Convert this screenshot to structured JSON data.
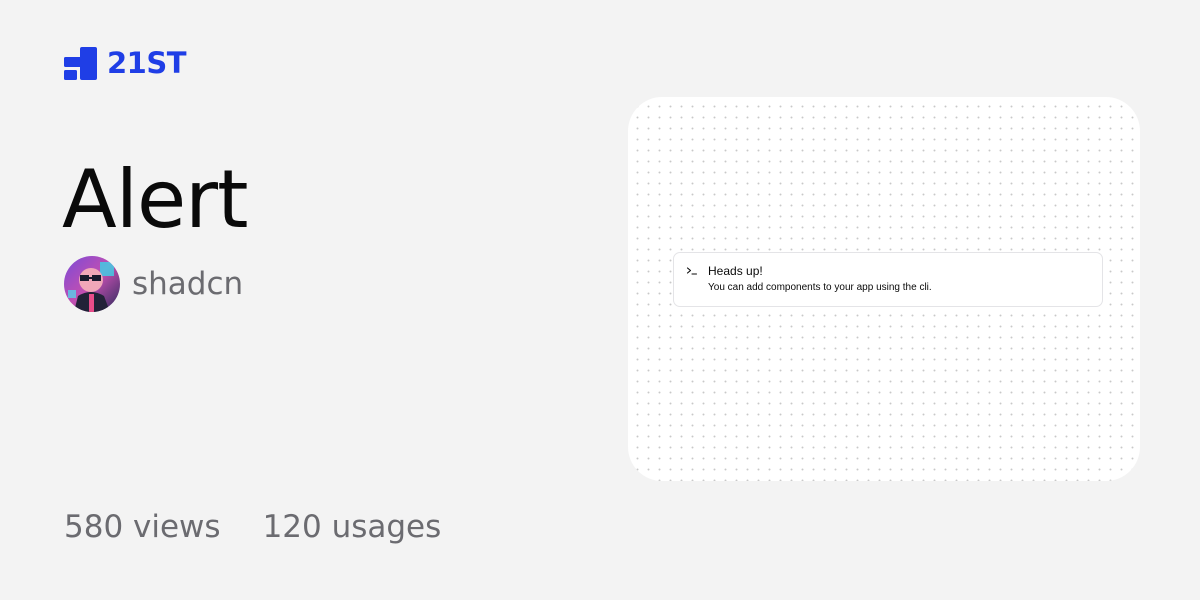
{
  "brand": {
    "name": "21ST",
    "color": "#1f3ee6"
  },
  "component": {
    "title": "Alert",
    "author": "shadcn"
  },
  "stats": {
    "views": "580 views",
    "usages": "120 usages"
  },
  "preview": {
    "alert_icon": "terminal-icon",
    "alert_title": "Heads up!",
    "alert_description": "You can add components to your app using the cli."
  }
}
